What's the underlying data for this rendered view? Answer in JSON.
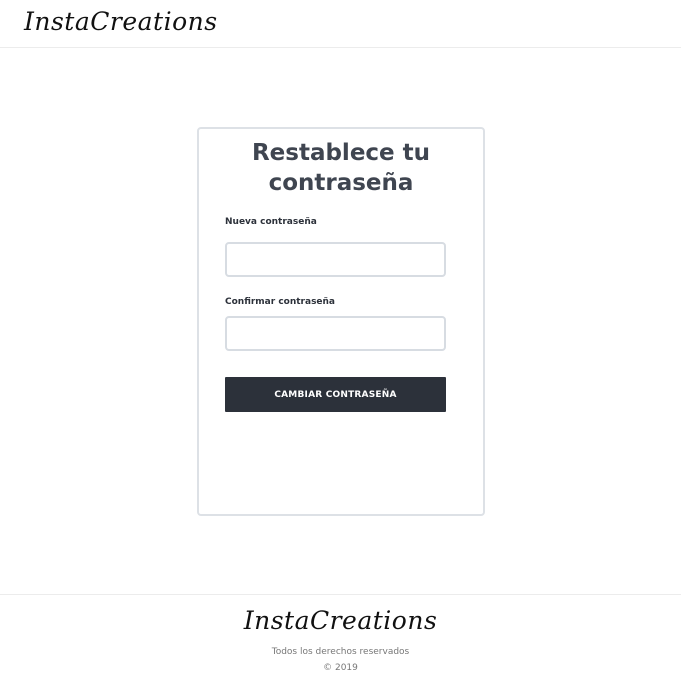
{
  "header": {
    "logo_text": "InstaCreations"
  },
  "reset_form": {
    "title": "Restablece tu contraseña",
    "new_password_label": "Nueva contraseña",
    "new_password_value": "",
    "confirm_password_label": "Confirmar contraseña",
    "confirm_password_value": "",
    "submit_label": "CAMBIAR CONTRASEÑA"
  },
  "footer": {
    "logo_text": "InstaCreations",
    "rights_text": "Todos los derechos reservados",
    "copyright_text": "© 2019"
  },
  "colors": {
    "button_bg": "#2c313a",
    "title_text": "#3f4550",
    "card_border": "#dde1e6"
  }
}
